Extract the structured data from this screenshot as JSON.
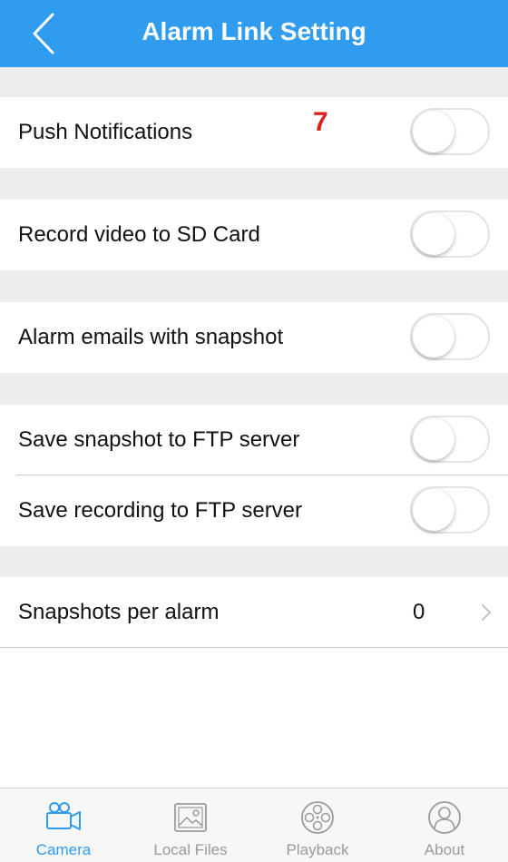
{
  "colors": {
    "nav_background": "#2f9cf0",
    "accent": "#2f9cf0",
    "section_gap": "#ededed",
    "annotation": "#e0201a",
    "inactive_tab": "#9a9a9a"
  },
  "header": {
    "title": "Alarm Link Setting",
    "back_icon": "chevron-left-icon"
  },
  "annotation": "7",
  "settings": {
    "push_notifications": {
      "label": "Push Notifications",
      "enabled": false
    },
    "record_sd": {
      "label": "Record video to SD Card",
      "enabled": false
    },
    "alarm_emails": {
      "label": "Alarm emails with snapshot",
      "enabled": false
    },
    "ftp_snapshot": {
      "label": "Save snapshot to FTP server",
      "enabled": false
    },
    "ftp_recording": {
      "label": "Save recording to FTP server",
      "enabled": false
    },
    "snapshots_per_alarm": {
      "label": "Snapshots per alarm",
      "value": "0"
    }
  },
  "tabbar": {
    "active": "Camera",
    "tabs": [
      {
        "label": "Camera",
        "icon": "camera-icon"
      },
      {
        "label": "Local Files",
        "icon": "picture-icon"
      },
      {
        "label": "Playback",
        "icon": "film-reel-icon"
      },
      {
        "label": "About",
        "icon": "user-circle-icon"
      }
    ]
  }
}
